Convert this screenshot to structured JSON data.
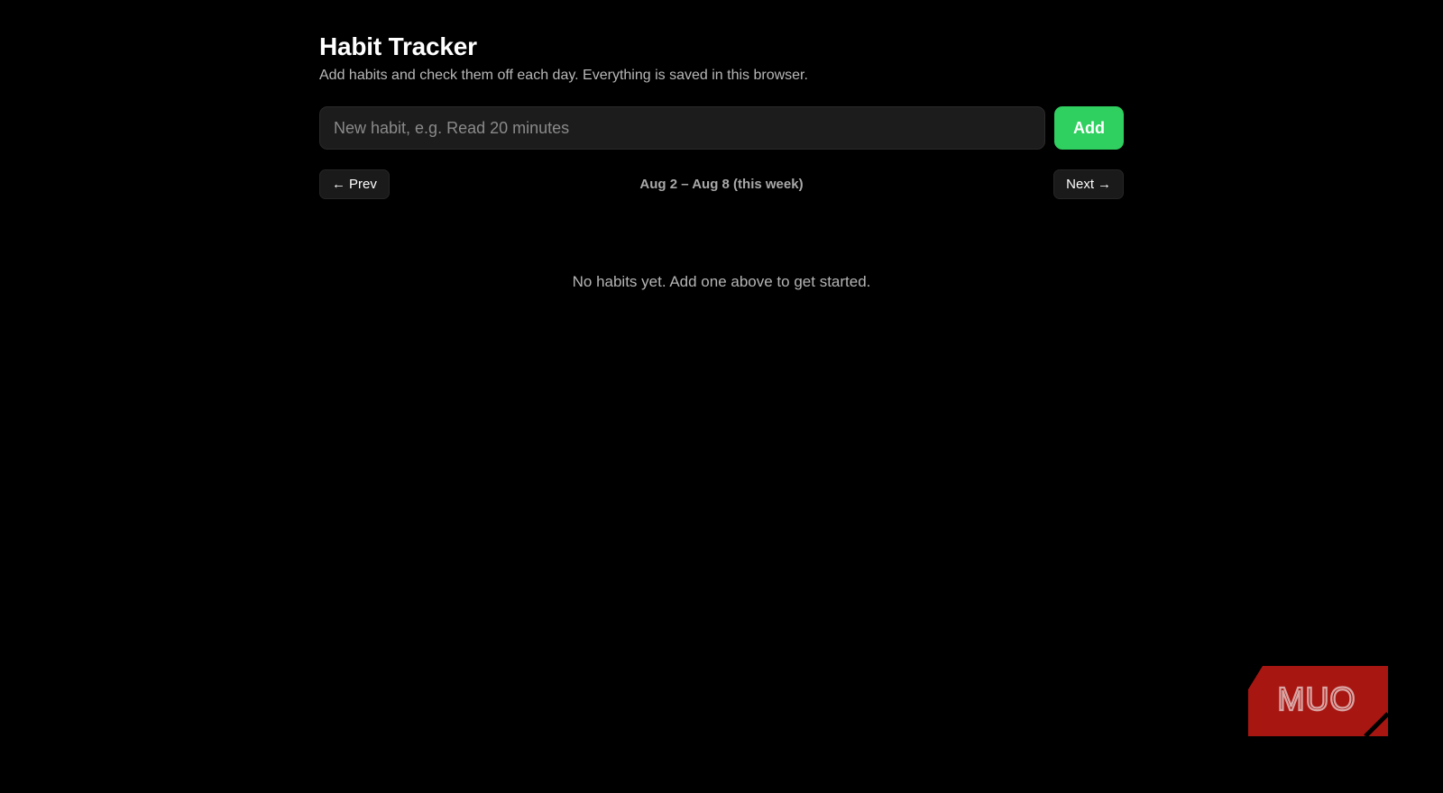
{
  "header": {
    "title": "Habit Tracker",
    "subtitle": "Add habits and check them off each day. Everything is saved in this browser."
  },
  "add_form": {
    "input_value": "",
    "input_placeholder": "New habit, e.g. Read 20 minutes",
    "add_label": "Add"
  },
  "week_nav": {
    "prev_arrow": "←",
    "prev_label": "Prev",
    "week_label": "Aug 2 – Aug 8 (this week)",
    "next_label": "Next",
    "next_arrow": "→"
  },
  "habits": {
    "empty_message": "No habits yet. Add one above to get started."
  },
  "watermark": {
    "text": "MUO"
  },
  "colors": {
    "background": "#000000",
    "accent": "#2fd060",
    "input_background": "#1c1c1c",
    "button_background": "#1a1a1a",
    "watermark_red": "#a81612"
  },
  "icons": {
    "prev": "arrow-left-icon",
    "next": "arrow-right-icon"
  }
}
